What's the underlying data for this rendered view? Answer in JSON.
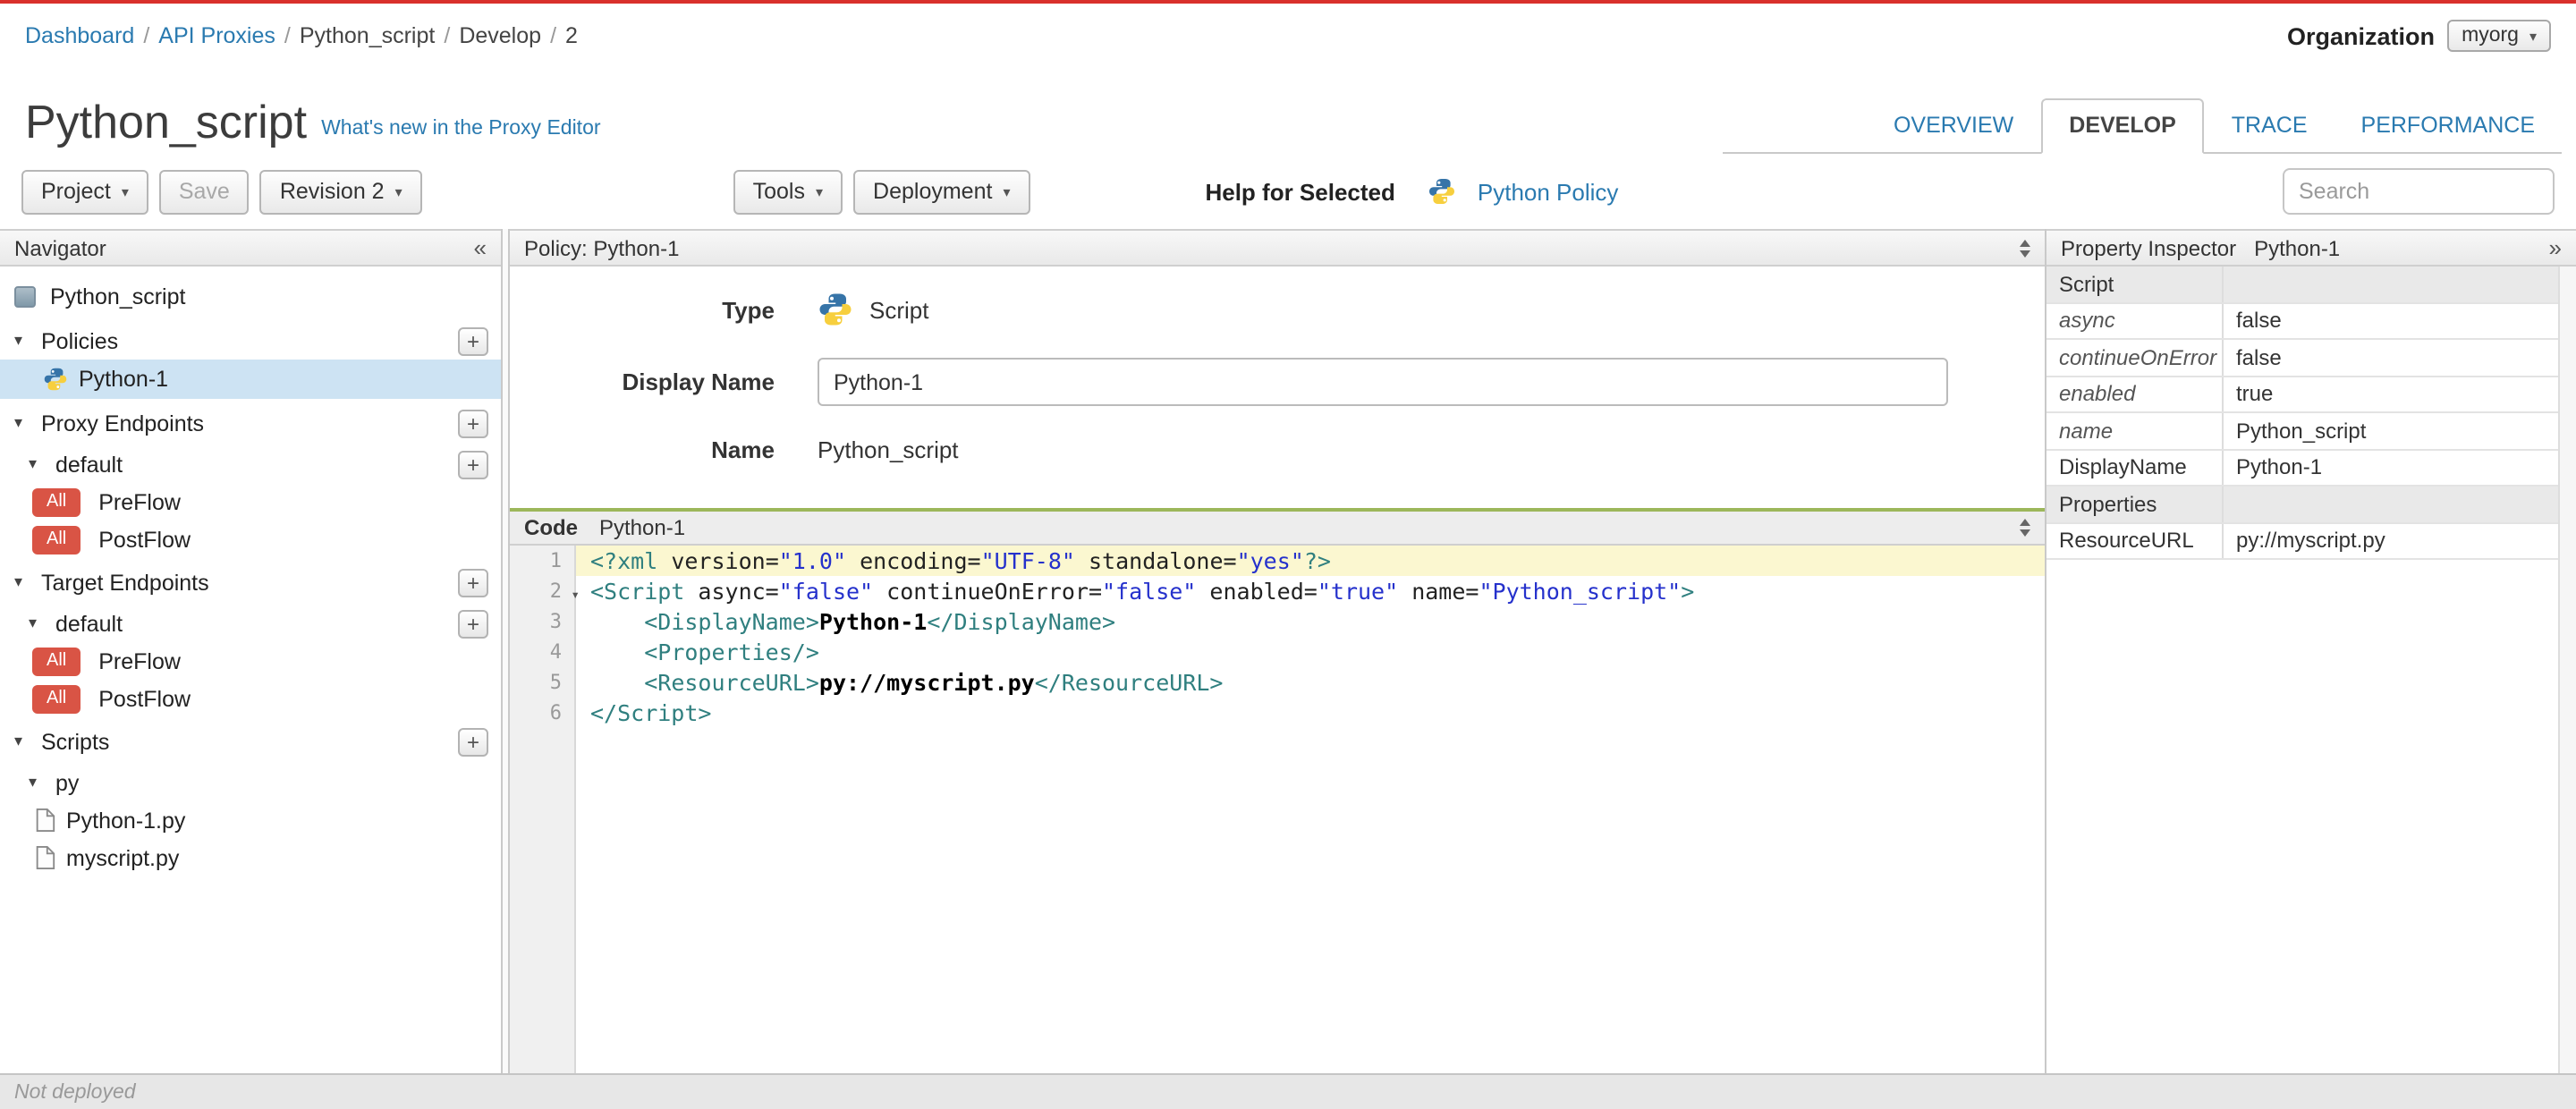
{
  "colors": {
    "top_accent": "#d9302c",
    "link": "#2a7ab0",
    "selected_row": "#cde3f3",
    "badge": "#d95445",
    "code_divider": "#9cb75a",
    "active_line": "#fbf7d0"
  },
  "breadcrumb": {
    "separator": "/",
    "items": [
      {
        "label": "Dashboard",
        "link": true
      },
      {
        "label": "API Proxies",
        "link": true
      },
      {
        "label": "Python_script",
        "link": false
      },
      {
        "label": "Develop",
        "link": false
      },
      {
        "label": "2",
        "link": false
      }
    ]
  },
  "organization": {
    "label": "Organization",
    "value": "myorg"
  },
  "header": {
    "title": "Python_script",
    "whats_new_link": "What's new in the Proxy Editor"
  },
  "tabs": [
    {
      "label": "OVERVIEW",
      "active": false
    },
    {
      "label": "DEVELOP",
      "active": true
    },
    {
      "label": "TRACE",
      "active": false
    },
    {
      "label": "PERFORMANCE",
      "active": false
    }
  ],
  "toolbar": {
    "project": "Project",
    "save": "Save",
    "revision": "Revision 2",
    "tools": "Tools",
    "deployment": "Deployment",
    "help_for_selected": "Help for Selected",
    "policy_link": "Python Policy",
    "search_placeholder": "Search"
  },
  "navigator": {
    "title": "Navigator",
    "items": [
      {
        "label": "Python_script",
        "type": "root",
        "icon": "proxy-icon",
        "level": 0
      },
      {
        "label": "Policies",
        "type": "section",
        "expanded": true,
        "plus": true,
        "level": 0
      },
      {
        "label": "Python-1",
        "type": "policy",
        "icon": "python-icon",
        "selected": true,
        "level": 1
      },
      {
        "label": "Proxy Endpoints",
        "type": "section",
        "expanded": true,
        "plus": true,
        "level": 0
      },
      {
        "label": "default",
        "type": "folder",
        "expanded": true,
        "plus": true,
        "level": 1
      },
      {
        "label": "PreFlow",
        "type": "flow",
        "badge": "All",
        "level": 2
      },
      {
        "label": "PostFlow",
        "type": "flow",
        "badge": "All",
        "level": 2
      },
      {
        "label": "Target Endpoints",
        "type": "section",
        "expanded": true,
        "plus": true,
        "level": 0
      },
      {
        "label": "default",
        "type": "folder",
        "expanded": true,
        "plus": true,
        "level": 1
      },
      {
        "label": "PreFlow",
        "type": "flow",
        "badge": "All",
        "level": 2
      },
      {
        "label": "PostFlow",
        "type": "flow",
        "badge": "All",
        "level": 2
      },
      {
        "label": "Scripts",
        "type": "section",
        "expanded": true,
        "plus": true,
        "level": 0
      },
      {
        "label": "py",
        "type": "folder",
        "expanded": true,
        "plus": false,
        "level": 1
      },
      {
        "label": "Python-1.py",
        "type": "file",
        "icon": "file-icon",
        "level": 2
      },
      {
        "label": "myscript.py",
        "type": "file",
        "icon": "file-icon",
        "level": 2
      }
    ]
  },
  "policy_panel": {
    "header": "Policy: Python-1",
    "type_label": "Type",
    "type_value": "Script",
    "display_name_label": "Display Name",
    "display_name_value": "Python-1",
    "name_label": "Name",
    "name_value": "Python_script"
  },
  "code_panel": {
    "tab_label": "Code",
    "title": "Python-1",
    "lines": [
      {
        "num": 1,
        "active": true,
        "segments": [
          {
            "t": "<?xml",
            "c": "tag"
          },
          {
            "t": " version=",
            "c": "attr"
          },
          {
            "t": "\"1.0\"",
            "c": "str"
          },
          {
            "t": " encoding=",
            "c": "attr"
          },
          {
            "t": "\"UTF-8\"",
            "c": "str"
          },
          {
            "t": " standalone=",
            "c": "attr"
          },
          {
            "t": "\"yes\"",
            "c": "str"
          },
          {
            "t": "?>",
            "c": "tag"
          }
        ]
      },
      {
        "num": 2,
        "fold": true,
        "segments": [
          {
            "t": "<Script",
            "c": "tag"
          },
          {
            "t": " async=",
            "c": "attr"
          },
          {
            "t": "\"false\"",
            "c": "str"
          },
          {
            "t": " continueOnError=",
            "c": "attr"
          },
          {
            "t": "\"false\"",
            "c": "str"
          },
          {
            "t": " enabled=",
            "c": "attr"
          },
          {
            "t": "\"true\"",
            "c": "str"
          },
          {
            "t": " name=",
            "c": "attr"
          },
          {
            "t": "\"Python_script\"",
            "c": "str"
          },
          {
            "t": ">",
            "c": "tag"
          }
        ]
      },
      {
        "num": 3,
        "segments": [
          {
            "t": "    ",
            "c": "plain"
          },
          {
            "t": "<DisplayName>",
            "c": "tag"
          },
          {
            "t": "Python-1",
            "c": "text"
          },
          {
            "t": "</DisplayName>",
            "c": "tag"
          }
        ]
      },
      {
        "num": 4,
        "segments": [
          {
            "t": "    ",
            "c": "plain"
          },
          {
            "t": "<Properties/>",
            "c": "tag"
          }
        ]
      },
      {
        "num": 5,
        "segments": [
          {
            "t": "    ",
            "c": "plain"
          },
          {
            "t": "<ResourceURL>",
            "c": "tag"
          },
          {
            "t": "py://myscript.py",
            "c": "text"
          },
          {
            "t": "</ResourceURL>",
            "c": "tag"
          }
        ]
      },
      {
        "num": 6,
        "segments": [
          {
            "t": "</Script>",
            "c": "tag"
          }
        ]
      }
    ]
  },
  "property_inspector": {
    "title": "Property Inspector",
    "subtitle": "Python-1",
    "rows": [
      {
        "label": "Script",
        "type": "section"
      },
      {
        "label": "async",
        "value": "false",
        "style": "attr"
      },
      {
        "label": "continueOnError",
        "value": "false",
        "style": "attr"
      },
      {
        "label": "enabled",
        "value": "true",
        "style": "attr"
      },
      {
        "label": "name",
        "value": "Python_script",
        "style": "attr"
      },
      {
        "label": "DisplayName",
        "value": "Python-1",
        "style": "elem"
      },
      {
        "label": "Properties",
        "type": "section"
      },
      {
        "label": "ResourceURL",
        "value": "py://myscript.py",
        "style": "elem"
      }
    ]
  },
  "status_bar": {
    "text": "Not deployed"
  }
}
